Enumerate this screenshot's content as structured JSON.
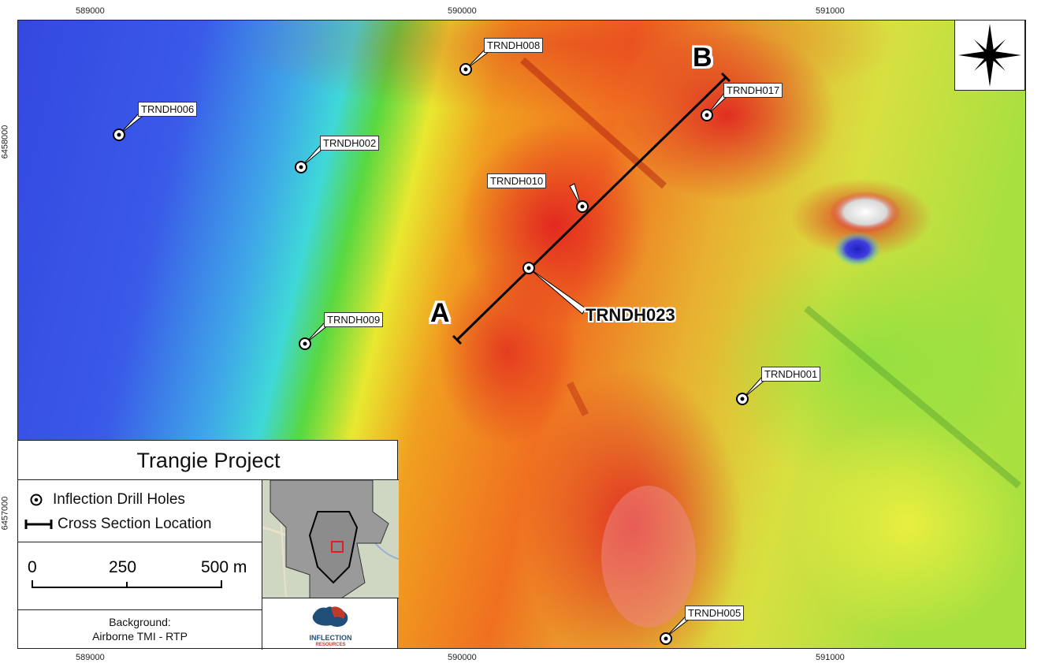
{
  "map": {
    "title": "Trangie Project",
    "x_ticks": [
      "589000",
      "590000",
      "591000"
    ],
    "y_ticks": [
      "6458000",
      "6457000"
    ],
    "section_start_label": "A",
    "section_end_label": "B",
    "drill_holes": [
      {
        "name": "TRNDH006"
      },
      {
        "name": "TRNDH002"
      },
      {
        "name": "TRNDH008"
      },
      {
        "name": "TRNDH017"
      },
      {
        "name": "TRNDH010"
      },
      {
        "name": "TRNDH023"
      },
      {
        "name": "TRNDH009"
      },
      {
        "name": "TRNDH001"
      },
      {
        "name": "TRNDH005"
      }
    ]
  },
  "legend": {
    "drill_holes_label": "Inflection Drill Holes",
    "cross_section_label": "Cross Section Location",
    "scale_labels": [
      "0",
      "250",
      "500 m"
    ],
    "background_line1": "Background:",
    "background_line2": "Airborne TMI - RTP",
    "logo_text_1": "INFLECTION",
    "logo_text_2": "RESOURCES"
  },
  "colors": {
    "low": "#3448e0",
    "mid_low": "#3fd8d8",
    "mid": "#58d840",
    "mid_high": "#e8e830",
    "high": "#f08a20",
    "peak": "#e02020",
    "inset_highlight": "#e02020"
  }
}
